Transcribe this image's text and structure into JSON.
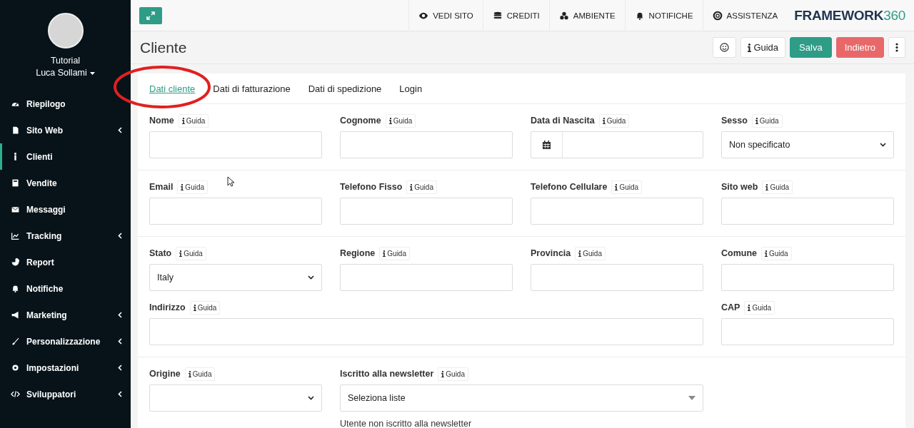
{
  "sidebar": {
    "user": {
      "role": "Tutorial",
      "name": "Luca Sollami"
    },
    "items": [
      {
        "label": "Riepilogo",
        "submenu": false,
        "selected": false
      },
      {
        "label": "Sito Web",
        "submenu": true,
        "selected": false
      },
      {
        "label": "Clienti",
        "submenu": false,
        "selected": true
      },
      {
        "label": "Vendite",
        "submenu": false,
        "selected": false
      },
      {
        "label": "Messaggi",
        "submenu": false,
        "selected": false
      },
      {
        "label": "Tracking",
        "submenu": true,
        "selected": false
      },
      {
        "label": "Report",
        "submenu": false,
        "selected": false
      },
      {
        "label": "Notifiche",
        "submenu": false,
        "selected": false
      },
      {
        "label": "Marketing",
        "submenu": true,
        "selected": false
      },
      {
        "label": "Personalizzazione",
        "submenu": true,
        "selected": false
      },
      {
        "label": "Impostazioni",
        "submenu": true,
        "selected": false
      },
      {
        "label": "Sviluppatori",
        "submenu": true,
        "selected": false
      }
    ]
  },
  "topbar": {
    "links": [
      "VEDI SITO",
      "CREDITI",
      "AMBIENTE",
      "NOTIFICHE",
      "ASSISTENZA"
    ],
    "logo": {
      "text": "FRAMEWORK",
      "suffix": "360"
    }
  },
  "page": {
    "title": "Cliente",
    "buttons": [
      {
        "kind": "icon"
      },
      {
        "kind": "help",
        "label": "Guida"
      },
      {
        "kind": "save",
        "label": "Salva"
      },
      {
        "kind": "back",
        "label": "Indietro"
      },
      {
        "kind": "more"
      }
    ]
  },
  "tabs": [
    {
      "label": "Dati cliente",
      "selected": true
    },
    {
      "label": "Dati di fatturazione",
      "selected": false
    },
    {
      "label": "Dati di spedizione",
      "selected": false
    },
    {
      "label": "Login",
      "selected": false
    }
  ],
  "sections": [
    {
      "fields": [
        {
          "label": "Nome",
          "help": "Guida",
          "kind": "text"
        },
        {
          "label": "Cognome",
          "help": "Guida",
          "kind": "text"
        },
        {
          "label": "Data di Nascita",
          "help": "Guida",
          "kind": "date"
        },
        {
          "label": "Sesso",
          "help": "Guida",
          "kind": "select",
          "value": "Non specificato"
        }
      ]
    },
    {
      "fields": [
        {
          "label": "Email",
          "help": "Guida",
          "kind": "text"
        },
        {
          "label": "Telefono Fisso",
          "help": "Guida",
          "kind": "text"
        },
        {
          "label": "Telefono Cellulare",
          "help": "Guida",
          "kind": "text"
        },
        {
          "label": "Sito web",
          "help": "Guida",
          "kind": "text"
        }
      ]
    },
    {
      "fields": [
        {
          "label": "Stato",
          "help": "Guida",
          "kind": "select",
          "value": "Italy"
        },
        {
          "label": "Regione",
          "help": "Guida",
          "kind": "text"
        },
        {
          "label": "Provincia",
          "help": "Guida",
          "kind": "text"
        },
        {
          "label": "Comune",
          "help": "Guida",
          "kind": "text"
        },
        {
          "label": "Indirizzo",
          "help": "Guida",
          "kind": "text"
        },
        {
          "label": "CAP",
          "help": "Guida",
          "kind": "text"
        }
      ]
    },
    {
      "fields": [
        {
          "label": "Origine",
          "help": "Guida",
          "kind": "select"
        },
        {
          "label": "Iscritto alla newsletter",
          "help": "Guida",
          "kind": "multiselect",
          "placeholder": "Seleziona liste",
          "note": "Utente non iscritto alla newsletter"
        }
      ]
    }
  ]
}
